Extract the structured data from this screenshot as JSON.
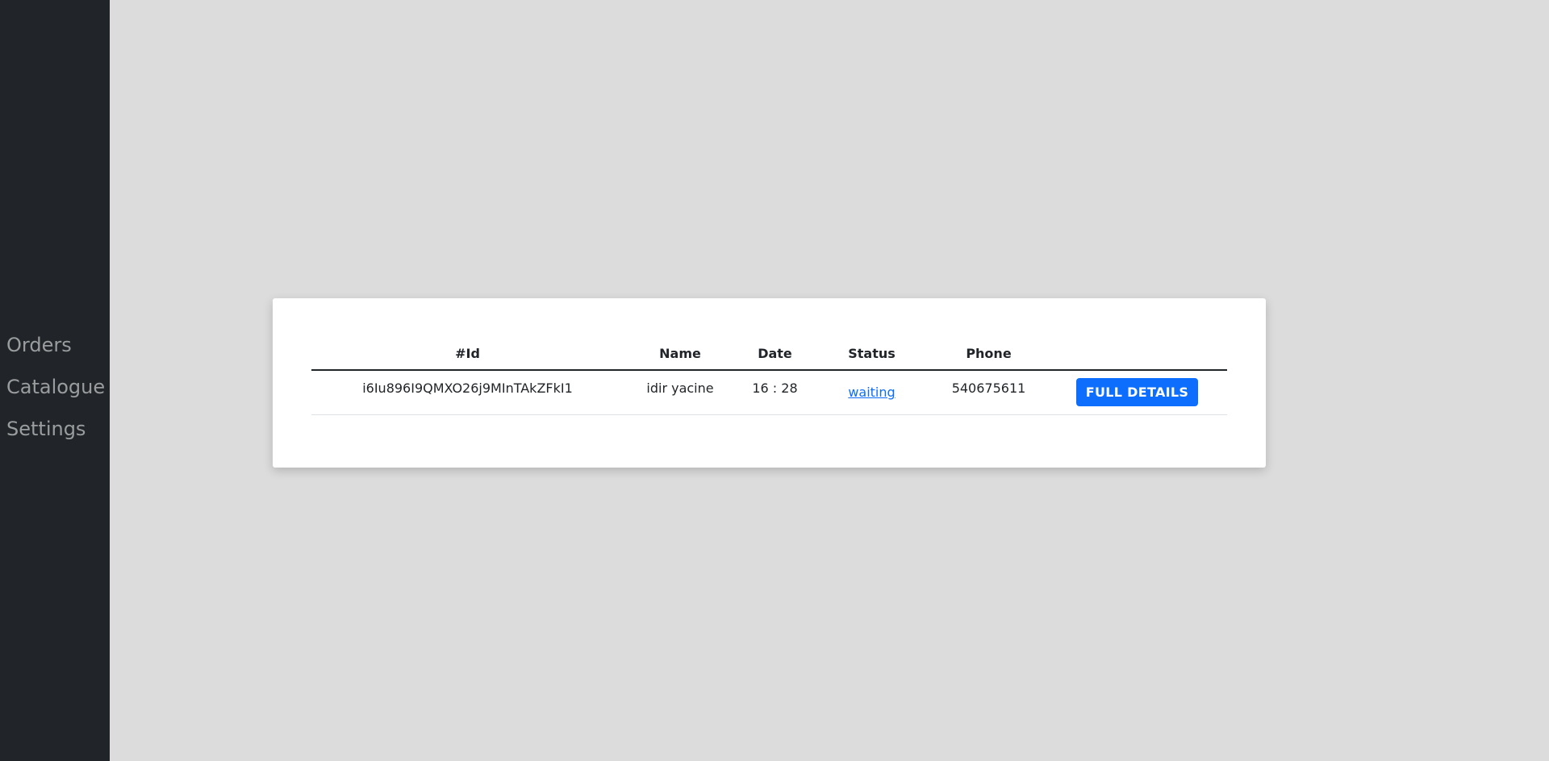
{
  "sidebar": {
    "items": [
      {
        "label": "Orders"
      },
      {
        "label": "Catalogue"
      },
      {
        "label": "Settings"
      }
    ]
  },
  "orders_table": {
    "headers": [
      "#Id",
      "Name",
      "Date",
      "Status",
      "Phone",
      ""
    ],
    "rows": [
      {
        "id": "i6Iu896I9QMXO26j9MInTAkZFkI1",
        "name": "idir yacine",
        "date": "16 : 28",
        "status": "waiting",
        "phone": "540675611",
        "action_label": "FULL DETAILS"
      }
    ]
  },
  "colors": {
    "sidebar_bg": "#212529",
    "page_bg": "#dcdcdc",
    "accent": "#0d6efd"
  }
}
